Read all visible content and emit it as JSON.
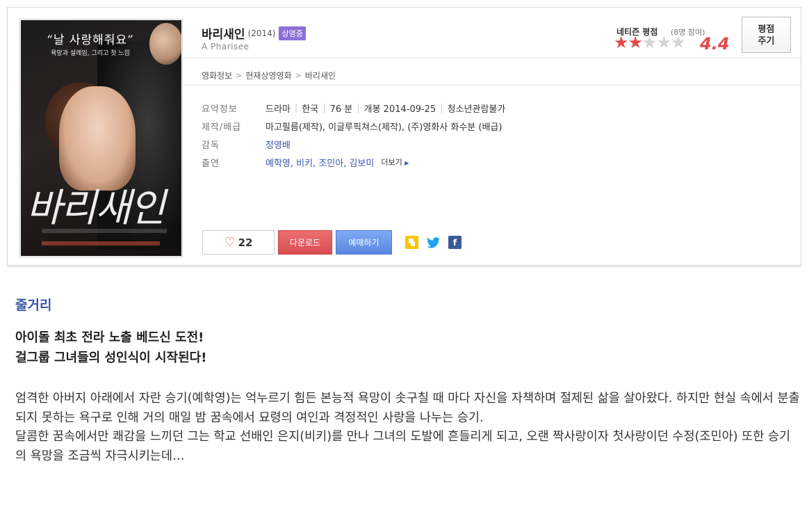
{
  "movie": {
    "title": "바리새인",
    "year": "(2014)",
    "status_badge": "상영중",
    "original_title": "A Pharisee"
  },
  "poster": {
    "quote": "“날 사랑해줘요”",
    "subquote": "욕망과 설레임, 그리고 첫 느낌",
    "calligraphy": "바리새인"
  },
  "rating": {
    "label": "네티즌 평점",
    "participants": "(8명 참여)",
    "score": "4.4",
    "stars_filled": 2,
    "stars_total": 5,
    "rate_button_line1": "평점",
    "rate_button_line2": "주기"
  },
  "breadcrumb": [
    "영화정보",
    "현재상영영화",
    "바리새인"
  ],
  "info": {
    "summary_label": "요약정보",
    "summary": [
      "드라마",
      "한국",
      "76 분",
      "개봉 2014-09-25",
      "청소년관람불가"
    ],
    "production_label": "제작/배급",
    "production": "마고필름(제작), 이글루픽쳐스(제작), (주)영화사 화수분 (배급)",
    "director_label": "감독",
    "director": "정영배",
    "cast_label": "출연",
    "cast": "예학영, 비키, 조민아, 김보미",
    "more": "더보기"
  },
  "actions": {
    "like_count": "22",
    "download": "다운로드",
    "reserve": "예매하기"
  },
  "icons": {
    "heart": "heart-outline-icon",
    "kakao": "kakaostory-icon",
    "twitter": "twitter-icon",
    "facebook": "facebook-icon"
  },
  "colors": {
    "accent_red": "#e5484a",
    "badge_purple": "#8b6fd8",
    "link_blue": "#3a57a7",
    "reserve_blue": "#5a88df"
  },
  "plot": {
    "title": "줄거리",
    "tagline_1": "아이돌 최초 전라 노출 베드신 도전!",
    "tagline_2": "걸그룹 그녀들의 성인식이 시작된다!",
    "text_1": "엄격한 아버지 아래에서 자란 승기(예학영)는 억누르기 힘든 본능적 욕망이 솟구칠 때 마다 자신을 자책하며 절제된 삶을 살아왔다. 하지만 현실 속에서 분출되지 못하는 욕구로 인해 거의 매일 밤 꿈속에서 묘령의 여인과 격정적인 사랑을 나누는 승기.",
    "text_2": "달콤한 꿈속에서만 쾌감을 느끼던 그는 학교 선배인 은지(비키)를 만나 그녀의 도발에 흔들리게 되고, 오랜 짝사랑이자 첫사랑이던 수정(조민아) 또한 승기의 욕망을 조금씩 자극시키는데…"
  }
}
